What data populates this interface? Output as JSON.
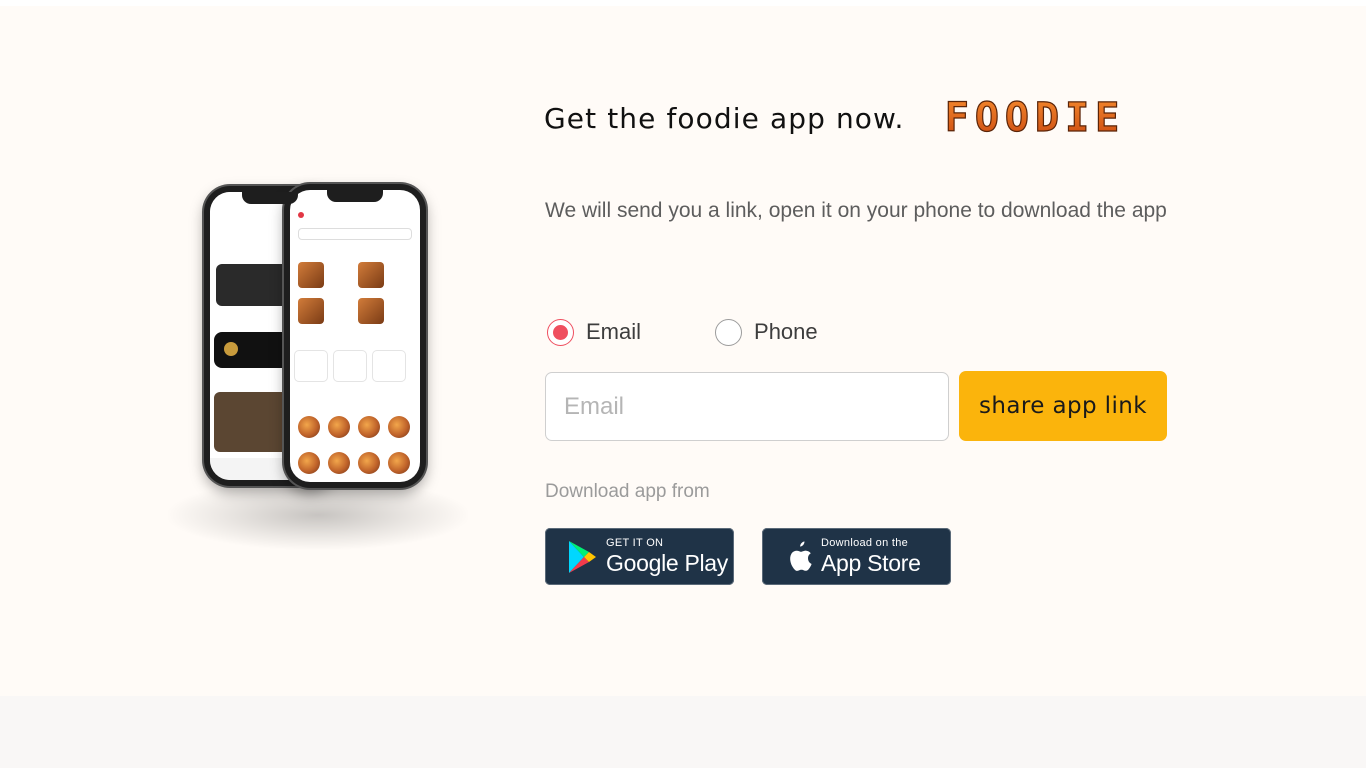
{
  "header": {
    "title": "Get the foodie app now.",
    "logo_text": "FOODIE"
  },
  "description": "We will send you a link, open it on your phone to download the app",
  "contact_method": {
    "options": [
      {
        "label": "Email",
        "selected": true
      },
      {
        "label": "Phone",
        "selected": false
      }
    ]
  },
  "form": {
    "email_value": "",
    "email_placeholder": "Email",
    "share_button_label": "share app link"
  },
  "download": {
    "label": "Download app from",
    "google_play": {
      "small": "GET IT ON",
      "big": "Google Play",
      "icon": "google-play-icon"
    },
    "app_store": {
      "small": "Download on the",
      "big": "App Store",
      "icon": "apple-icon"
    }
  },
  "colors": {
    "accent_red": "#ef4f5f",
    "button_yellow": "#fbb40c",
    "badge_bg": "#1f3347",
    "section_bg": "#fffbf7",
    "logo_orange": "#e8651d"
  }
}
